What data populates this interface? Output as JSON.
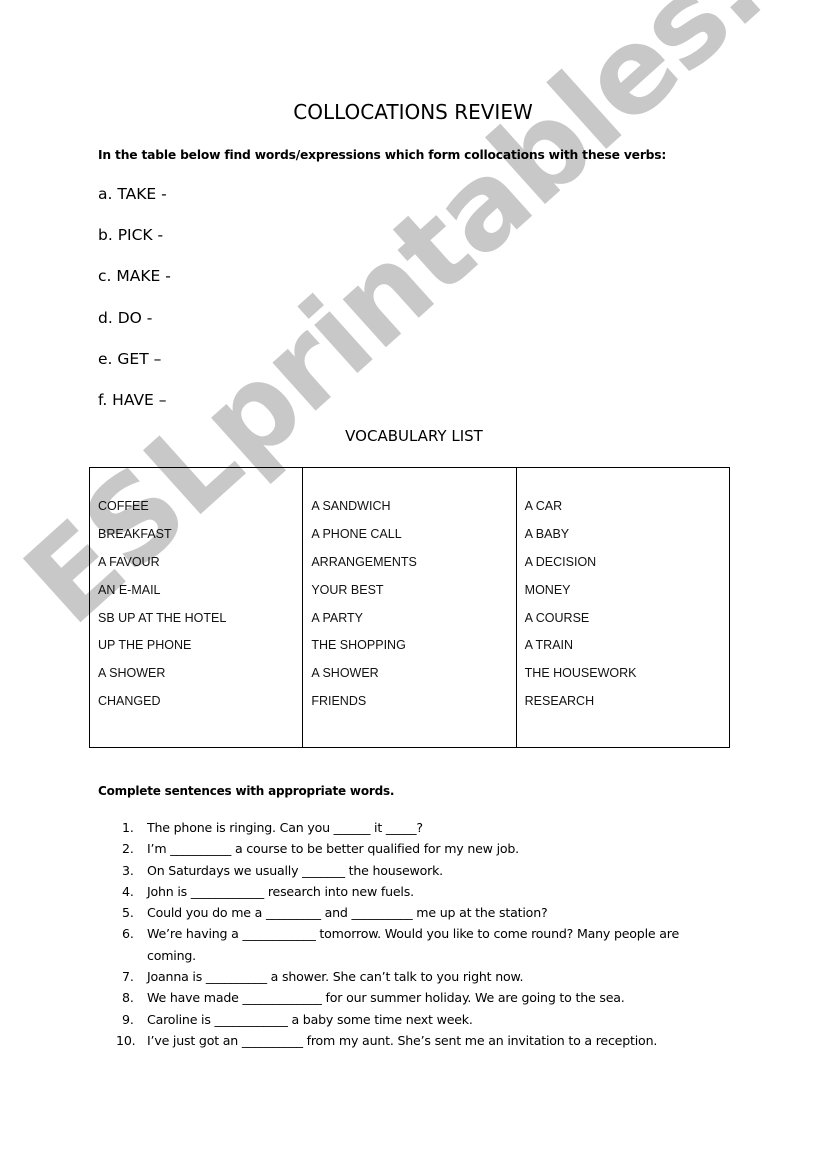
{
  "watermark": {
    "text": "ESLprintables.com",
    "color": "#c8c8c8"
  },
  "document": {
    "title": "COLLOCATIONS REVIEW",
    "instruction": "In the table below find words/expressions which form collocations with these verbs:",
    "verbs": [
      "a. TAKE -",
      "b. PICK -",
      "c. MAKE -",
      "d. DO -",
      "e. GET –",
      "f. HAVE –"
    ],
    "vocabulary": {
      "title": "VOCABULARY LIST",
      "columns": [
        [
          "COFFEE",
          "BREAKFAST",
          "A FAVOUR",
          "AN E-MAIL",
          "SB UP AT THE HOTEL",
          "UP THE PHONE",
          "A SHOWER",
          "CHANGED"
        ],
        [
          "A SANDWICH",
          "A PHONE CALL",
          "ARRANGEMENTS",
          "YOUR BEST",
          "A PARTY",
          "THE SHOPPING",
          "A SHOWER",
          "FRIENDS"
        ],
        [
          "A CAR",
          "A BABY",
          "A DECISION",
          "MONEY",
          "A COURSE",
          "A TRAIN",
          "THE HOUSEWORK",
          "RESEARCH"
        ]
      ]
    },
    "exercise": {
      "instruction": "Complete sentences with appropriate words.",
      "sentences": [
        {
          "num": "1.",
          "text": "The phone is ringing. Can you ______ it _____?"
        },
        {
          "num": "2.",
          "text": "I’m __________ a course to be better qualified for my new job."
        },
        {
          "num": "3.",
          "text": "On Saturdays we usually _______ the housework."
        },
        {
          "num": "4.",
          "text": "John is ____________ research into new fuels."
        },
        {
          "num": "5.",
          "text": "Could you do me a _________ and __________ me up at the station?"
        },
        {
          "num": "6.",
          "text": "We’re having a ____________ tomorrow.  Would you like to come round? Many people are coming."
        },
        {
          "num": "7.",
          "text": "Joanna is __________ a shower.  She can’t talk to you right now."
        },
        {
          "num": "8.",
          "text": "We have made _____________ for our summer holiday. We are going to the sea."
        },
        {
          "num": "9.",
          "text": "Caroline is ____________ a baby some time next week."
        },
        {
          "num": "10.",
          "text": "I’ve just got an __________ from my aunt. She’s sent me an invitation to a reception."
        }
      ]
    }
  }
}
